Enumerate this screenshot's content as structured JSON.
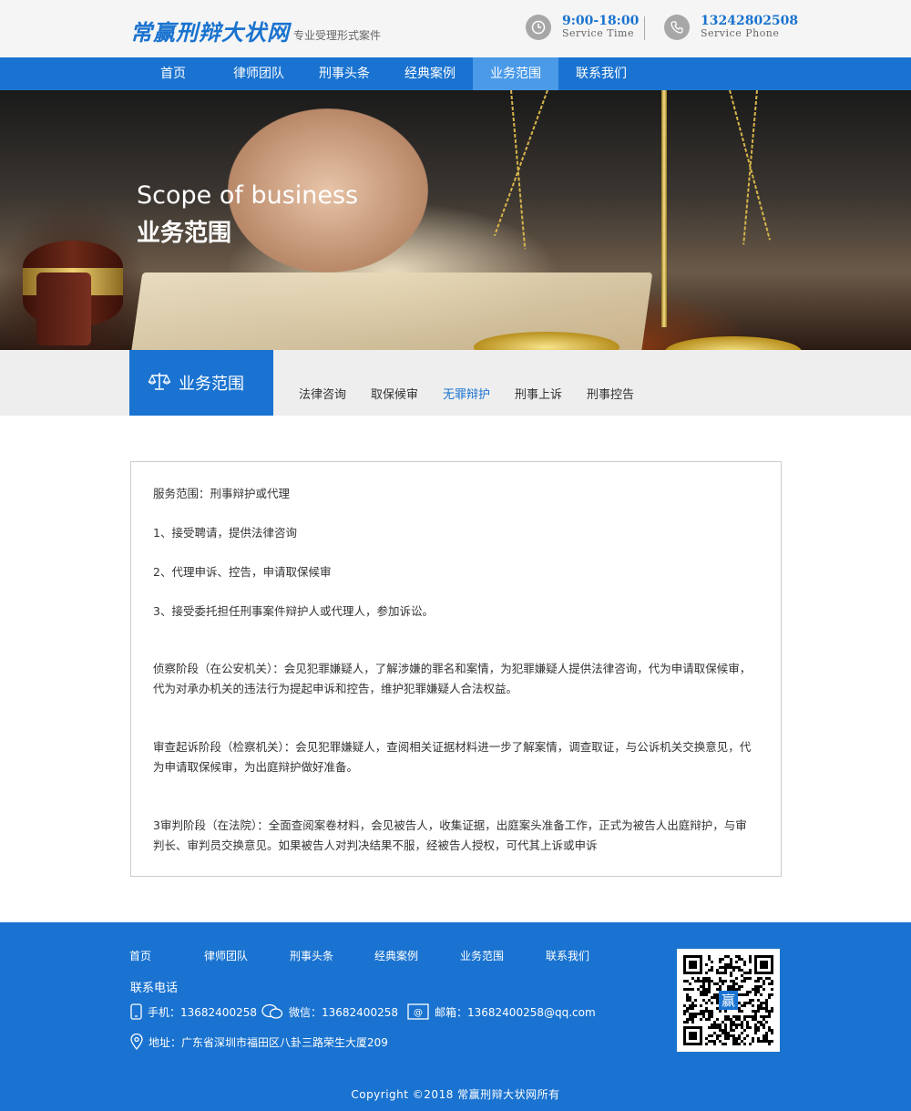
{
  "header": {
    "logo": "常赢刑辩大状网",
    "slogan": "专业受理形式案件",
    "time": {
      "value": "9:00-18:00",
      "label": "Service Time",
      "icon": "clock-icon"
    },
    "phone": {
      "value": "13242802508",
      "label": "Service Phone",
      "icon": "phone-icon"
    }
  },
  "nav": {
    "items": [
      {
        "label": "首页"
      },
      {
        "label": "律师团队"
      },
      {
        "label": "刑事头条"
      },
      {
        "label": "经典案例"
      },
      {
        "label": "业务范围"
      },
      {
        "label": "联系我们"
      }
    ],
    "active": "业务范围"
  },
  "banner": {
    "en": "Scope of business",
    "cn": "业务范围"
  },
  "subnav": {
    "title": "业务范围",
    "items": [
      {
        "label": "法律咨询"
      },
      {
        "label": "取保候审"
      },
      {
        "label": "无罪辩护"
      },
      {
        "label": "刑事上诉"
      },
      {
        "label": "刑事控告"
      }
    ],
    "active": "无罪辩护"
  },
  "content": {
    "p1": " 服务范围：刑事辩护或代理",
    "p2": "1、接受聘请，提供法律咨询",
    "p3": "2、代理申诉、控告，申请取保候审",
    "p4": "3、接受委托担任刑事案件辩护人或代理人，参加诉讼。",
    "p5": "侦察阶段（在公安机关）：会见犯罪嫌疑人，了解涉嫌的罪名和案情，为犯罪嫌疑人提供法律咨询，代为申请取保候审，代为对承办机关的违法行为提起申诉和控告，维护犯罪嫌疑人合法权益。",
    "p6": "审查起诉阶段（检察机关）：会见犯罪嫌疑人，查阅相关证据材料进一步了解案情，调查取证，与公诉机关交换意见，代为申请取保候审，为出庭辩护做好准备。",
    "p7": "3审判阶段（在法院）：全面查阅案卷材料，会见被告人，收集证据，出庭案头准备工作，正式为被告人出庭辩护，与审判长、审判员交换意见。如果被告人对判决结果不服，经被告人授权，可代其上诉或申诉"
  },
  "footer": {
    "nav": [
      {
        "label": "首页"
      },
      {
        "label": "律师团队"
      },
      {
        "label": "刑事头条"
      },
      {
        "label": "经典案例"
      },
      {
        "label": "业务范围"
      },
      {
        "label": "联系我们"
      }
    ],
    "heading": "联系电话",
    "mobile": "手机：13682400258",
    "wechat": "微信：13682400258",
    "email": "邮箱：13682400258@qq.com",
    "address": "地址：广东省深圳市福田区八卦三路荣生大厦209",
    "qr_center": "赢",
    "copyright": "Copyright ©2018  常赢刑辩大状网所有"
  },
  "colors": {
    "primary": "#1a73d0",
    "nav_active": "#4a9ae8",
    "header_bg": "#f5f5f5",
    "subnav_bg": "#eeeeee"
  }
}
